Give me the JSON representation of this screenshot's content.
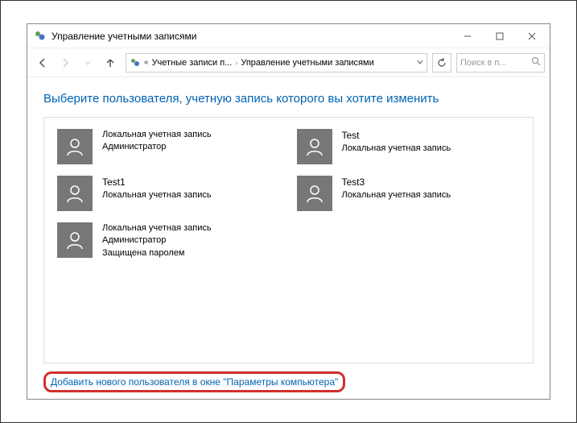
{
  "window": {
    "title": "Управление учетными записями"
  },
  "nav": {
    "breadcrumb": [
      "Учетные записи п...",
      "Управление учетными записями"
    ],
    "chevron_prefix": "«"
  },
  "search": {
    "placeholder": "Поиск в п..."
  },
  "main": {
    "heading": "Выберите пользователя, учетную запись которого вы хотите изменить",
    "users": [
      {
        "name": "",
        "line1": "Локальная учетная запись",
        "line2": "Администратор",
        "line3": ""
      },
      {
        "name": "Test",
        "line1": "Локальная учетная запись",
        "line2": "",
        "line3": ""
      },
      {
        "name": "Test1",
        "line1": "Локальная учетная запись",
        "line2": "",
        "line3": ""
      },
      {
        "name": "Test3",
        "line1": "Локальная учетная запись",
        "line2": "",
        "line3": ""
      },
      {
        "name": "",
        "line1": "Локальная учетная запись",
        "line2": "Администратор",
        "line3": "Защищена паролем"
      }
    ],
    "add_user_link": "Добавить нового пользователя в окне \"Параметры компьютера\""
  }
}
